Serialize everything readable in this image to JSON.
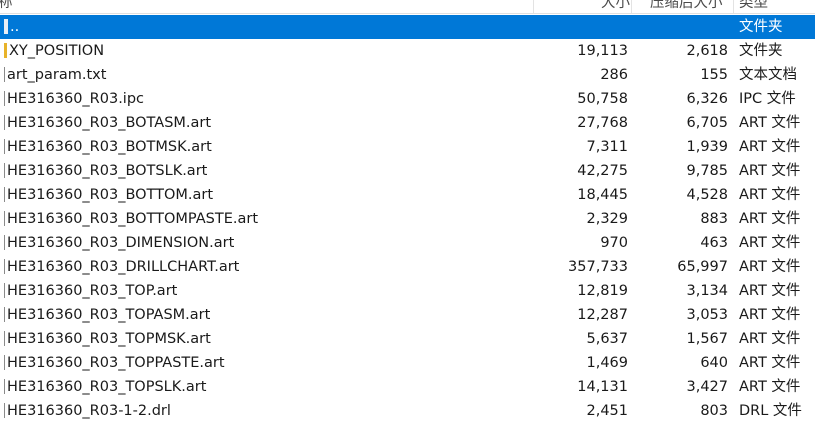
{
  "columns": {
    "name": "称",
    "size": "大小",
    "packed": "压缩后大小",
    "type": "类型"
  },
  "rows": [
    {
      "icon": "up-folder-icon",
      "name": "..",
      "size": "",
      "packed": "",
      "type": "文件夹",
      "selected": true
    },
    {
      "icon": "folder-icon",
      "name": "XY_POSITION",
      "size": "19,113",
      "packed": "2,618",
      "type": "文件夹"
    },
    {
      "icon": "file-icon",
      "name": "art_param.txt",
      "size": "286",
      "packed": "155",
      "type": "文本文档"
    },
    {
      "icon": "file-icon",
      "name": "HE316360_R03.ipc",
      "size": "50,758",
      "packed": "6,326",
      "type": "IPC 文件"
    },
    {
      "icon": "file-icon",
      "name": "HE316360_R03_BOTASM.art",
      "size": "27,768",
      "packed": "6,705",
      "type": "ART 文件"
    },
    {
      "icon": "file-icon",
      "name": "HE316360_R03_BOTMSK.art",
      "size": "7,311",
      "packed": "1,939",
      "type": "ART 文件"
    },
    {
      "icon": "file-icon",
      "name": "HE316360_R03_BOTSLK.art",
      "size": "42,275",
      "packed": "9,785",
      "type": "ART 文件"
    },
    {
      "icon": "file-icon",
      "name": "HE316360_R03_BOTTOM.art",
      "size": "18,445",
      "packed": "4,528",
      "type": "ART 文件"
    },
    {
      "icon": "file-icon",
      "name": "HE316360_R03_BOTTOMPASTE.art",
      "size": "2,329",
      "packed": "883",
      "type": "ART 文件"
    },
    {
      "icon": "file-icon",
      "name": "HE316360_R03_DIMENSION.art",
      "size": "970",
      "packed": "463",
      "type": "ART 文件"
    },
    {
      "icon": "file-icon",
      "name": "HE316360_R03_DRILLCHART.art",
      "size": "357,733",
      "packed": "65,997",
      "type": "ART 文件"
    },
    {
      "icon": "file-icon",
      "name": "HE316360_R03_TOP.art",
      "size": "12,819",
      "packed": "3,134",
      "type": "ART 文件"
    },
    {
      "icon": "file-icon",
      "name": "HE316360_R03_TOPASM.art",
      "size": "12,287",
      "packed": "3,053",
      "type": "ART 文件"
    },
    {
      "icon": "file-icon",
      "name": "HE316360_R03_TOPMSK.art",
      "size": "5,637",
      "packed": "1,567",
      "type": "ART 文件"
    },
    {
      "icon": "file-icon",
      "name": "HE316360_R03_TOPPASTE.art",
      "size": "1,469",
      "packed": "640",
      "type": "ART 文件"
    },
    {
      "icon": "file-icon",
      "name": "HE316360_R03_TOPSLK.art",
      "size": "14,131",
      "packed": "3,427",
      "type": "ART 文件"
    },
    {
      "icon": "file-icon",
      "name": "HE316360_R03-1-2.drl",
      "size": "2,451",
      "packed": "803",
      "type": "DRL 文件"
    }
  ],
  "colors": {
    "selection": "#0078d7",
    "folder": "#e8b32a"
  }
}
